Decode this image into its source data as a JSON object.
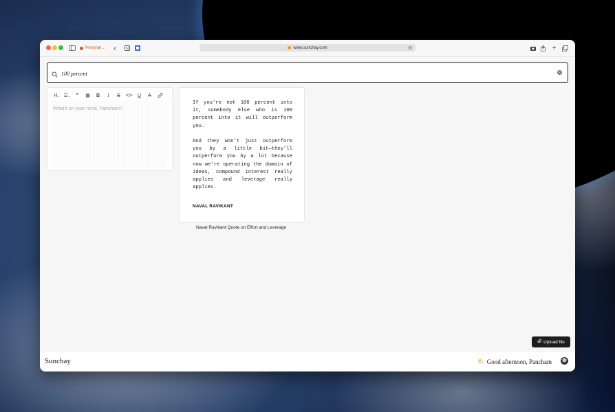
{
  "browser": {
    "profile_label": "Personal",
    "url": "www.sunchay.com"
  },
  "search": {
    "value": "100 percent"
  },
  "editor": {
    "toolbar": {
      "heading": "H",
      "list": "☰",
      "bold": "B",
      "italic": "I",
      "strike": "S",
      "code": "</>",
      "underline": "U",
      "highlight": "A",
      "link": "🔗"
    },
    "placeholder": "What's on your mind, Pancham?"
  },
  "quote": {
    "paragraph1": "If you're not 100 percent into it, somebody else who is 100 percent into it will outperform you.",
    "paragraph2": "And they won't just outperform you by a little bit—they'll outperform you by a lot because now we're operating the domain of ideas, compound interest really applies and leverage really applies.",
    "author": "NAVAL RAVIKANT",
    "caption": "Naval Ravikant Quote on Effort and Leverage"
  },
  "upload": {
    "label": "Upload file"
  },
  "footer": {
    "brand": "Sunchay",
    "greeting": "Good afternoon, Pancham"
  }
}
